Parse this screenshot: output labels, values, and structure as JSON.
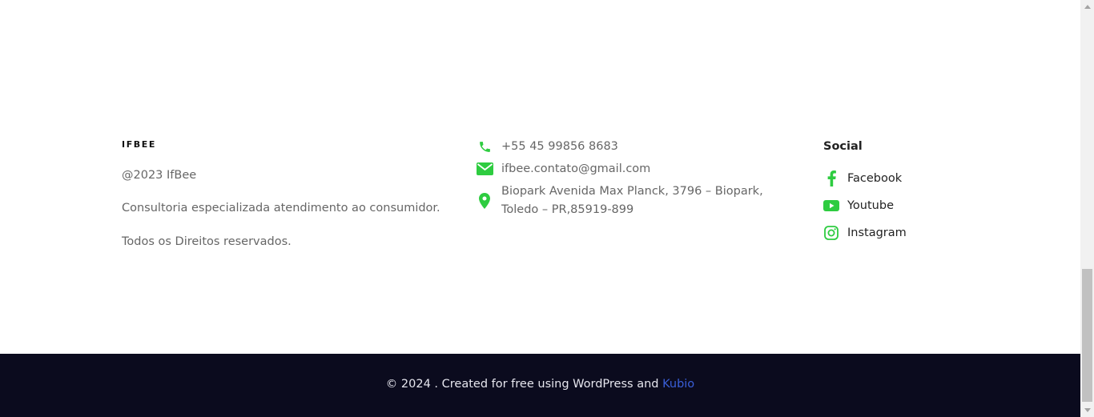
{
  "brand": {
    "name": "IFBEE",
    "year_line": "@2023 IfBee",
    "description": "Consultoria especializada atendimento ao consumidor.",
    "rights": "Todos os Direitos reservados."
  },
  "contact": {
    "phone": "+55 45 99856 8683",
    "email": "ifbee.contato@gmail.com",
    "address": "Biopark Avenida Max Planck, 3796 – Biopark, Toledo – PR,85919-899"
  },
  "social": {
    "title": "Social",
    "items": [
      {
        "label": "Facebook",
        "icon": "facebook-icon"
      },
      {
        "label": "Youtube",
        "icon": "youtube-icon"
      },
      {
        "label": "Instagram",
        "icon": "instagram-icon"
      }
    ]
  },
  "footer": {
    "copyright_text": "© 2024 . Created for free using WordPress and",
    "link_label": "Kubio"
  },
  "colors": {
    "accent": "#2ecc40",
    "footer_bg": "#0b0b1e",
    "link": "#3a5fd9"
  }
}
